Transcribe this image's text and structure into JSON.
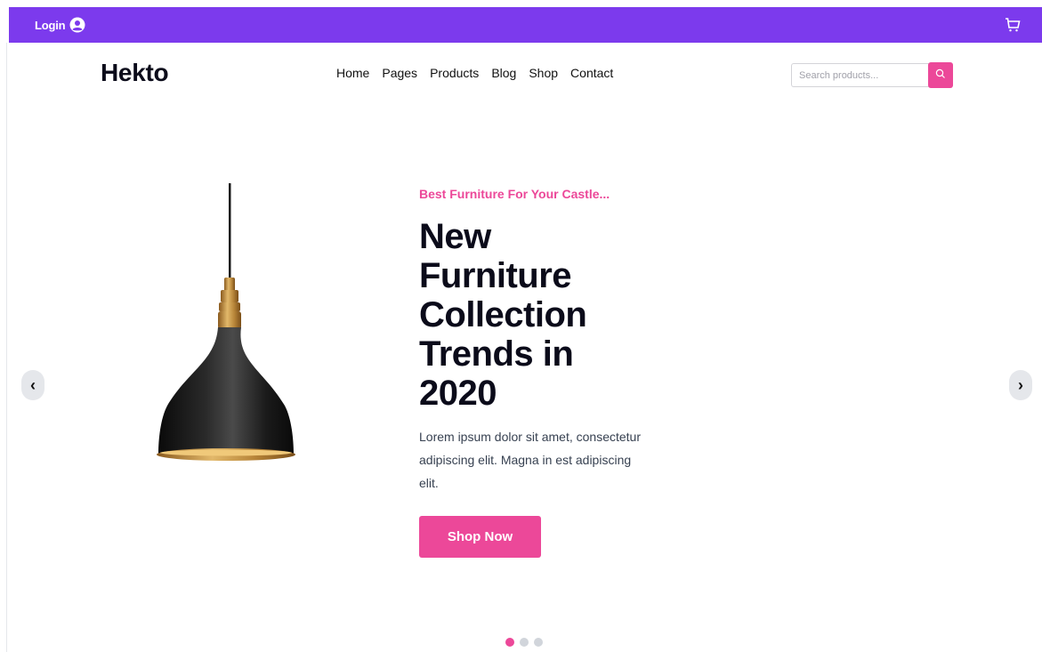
{
  "topbar": {
    "login_label": "Login",
    "user_icon": "user-circle-icon",
    "cart_icon": "cart-icon",
    "bg_color": "#7c3aed"
  },
  "header": {
    "logo": "Hekto",
    "nav": [
      "Home",
      "Pages",
      "Products",
      "Blog",
      "Shop",
      "Contact"
    ],
    "search_placeholder": "Search products...",
    "search_icon": "search-icon",
    "accent_color": "#ec4899"
  },
  "hero": {
    "subtitle": "Best Furniture For Your Castle...",
    "title_lines": [
      "New",
      "Furniture",
      "Collection",
      "Trends in",
      "2020"
    ],
    "description": "Lorem ipsum dolor sit amet, consectetur adipiscing elit. Magna in est adipiscing elit.",
    "cta_label": "Shop Now",
    "image": "pendant-lamp"
  },
  "carousel": {
    "prev_glyph": "‹",
    "next_glyph": "›",
    "slide_count": 3,
    "active_index": 0
  }
}
